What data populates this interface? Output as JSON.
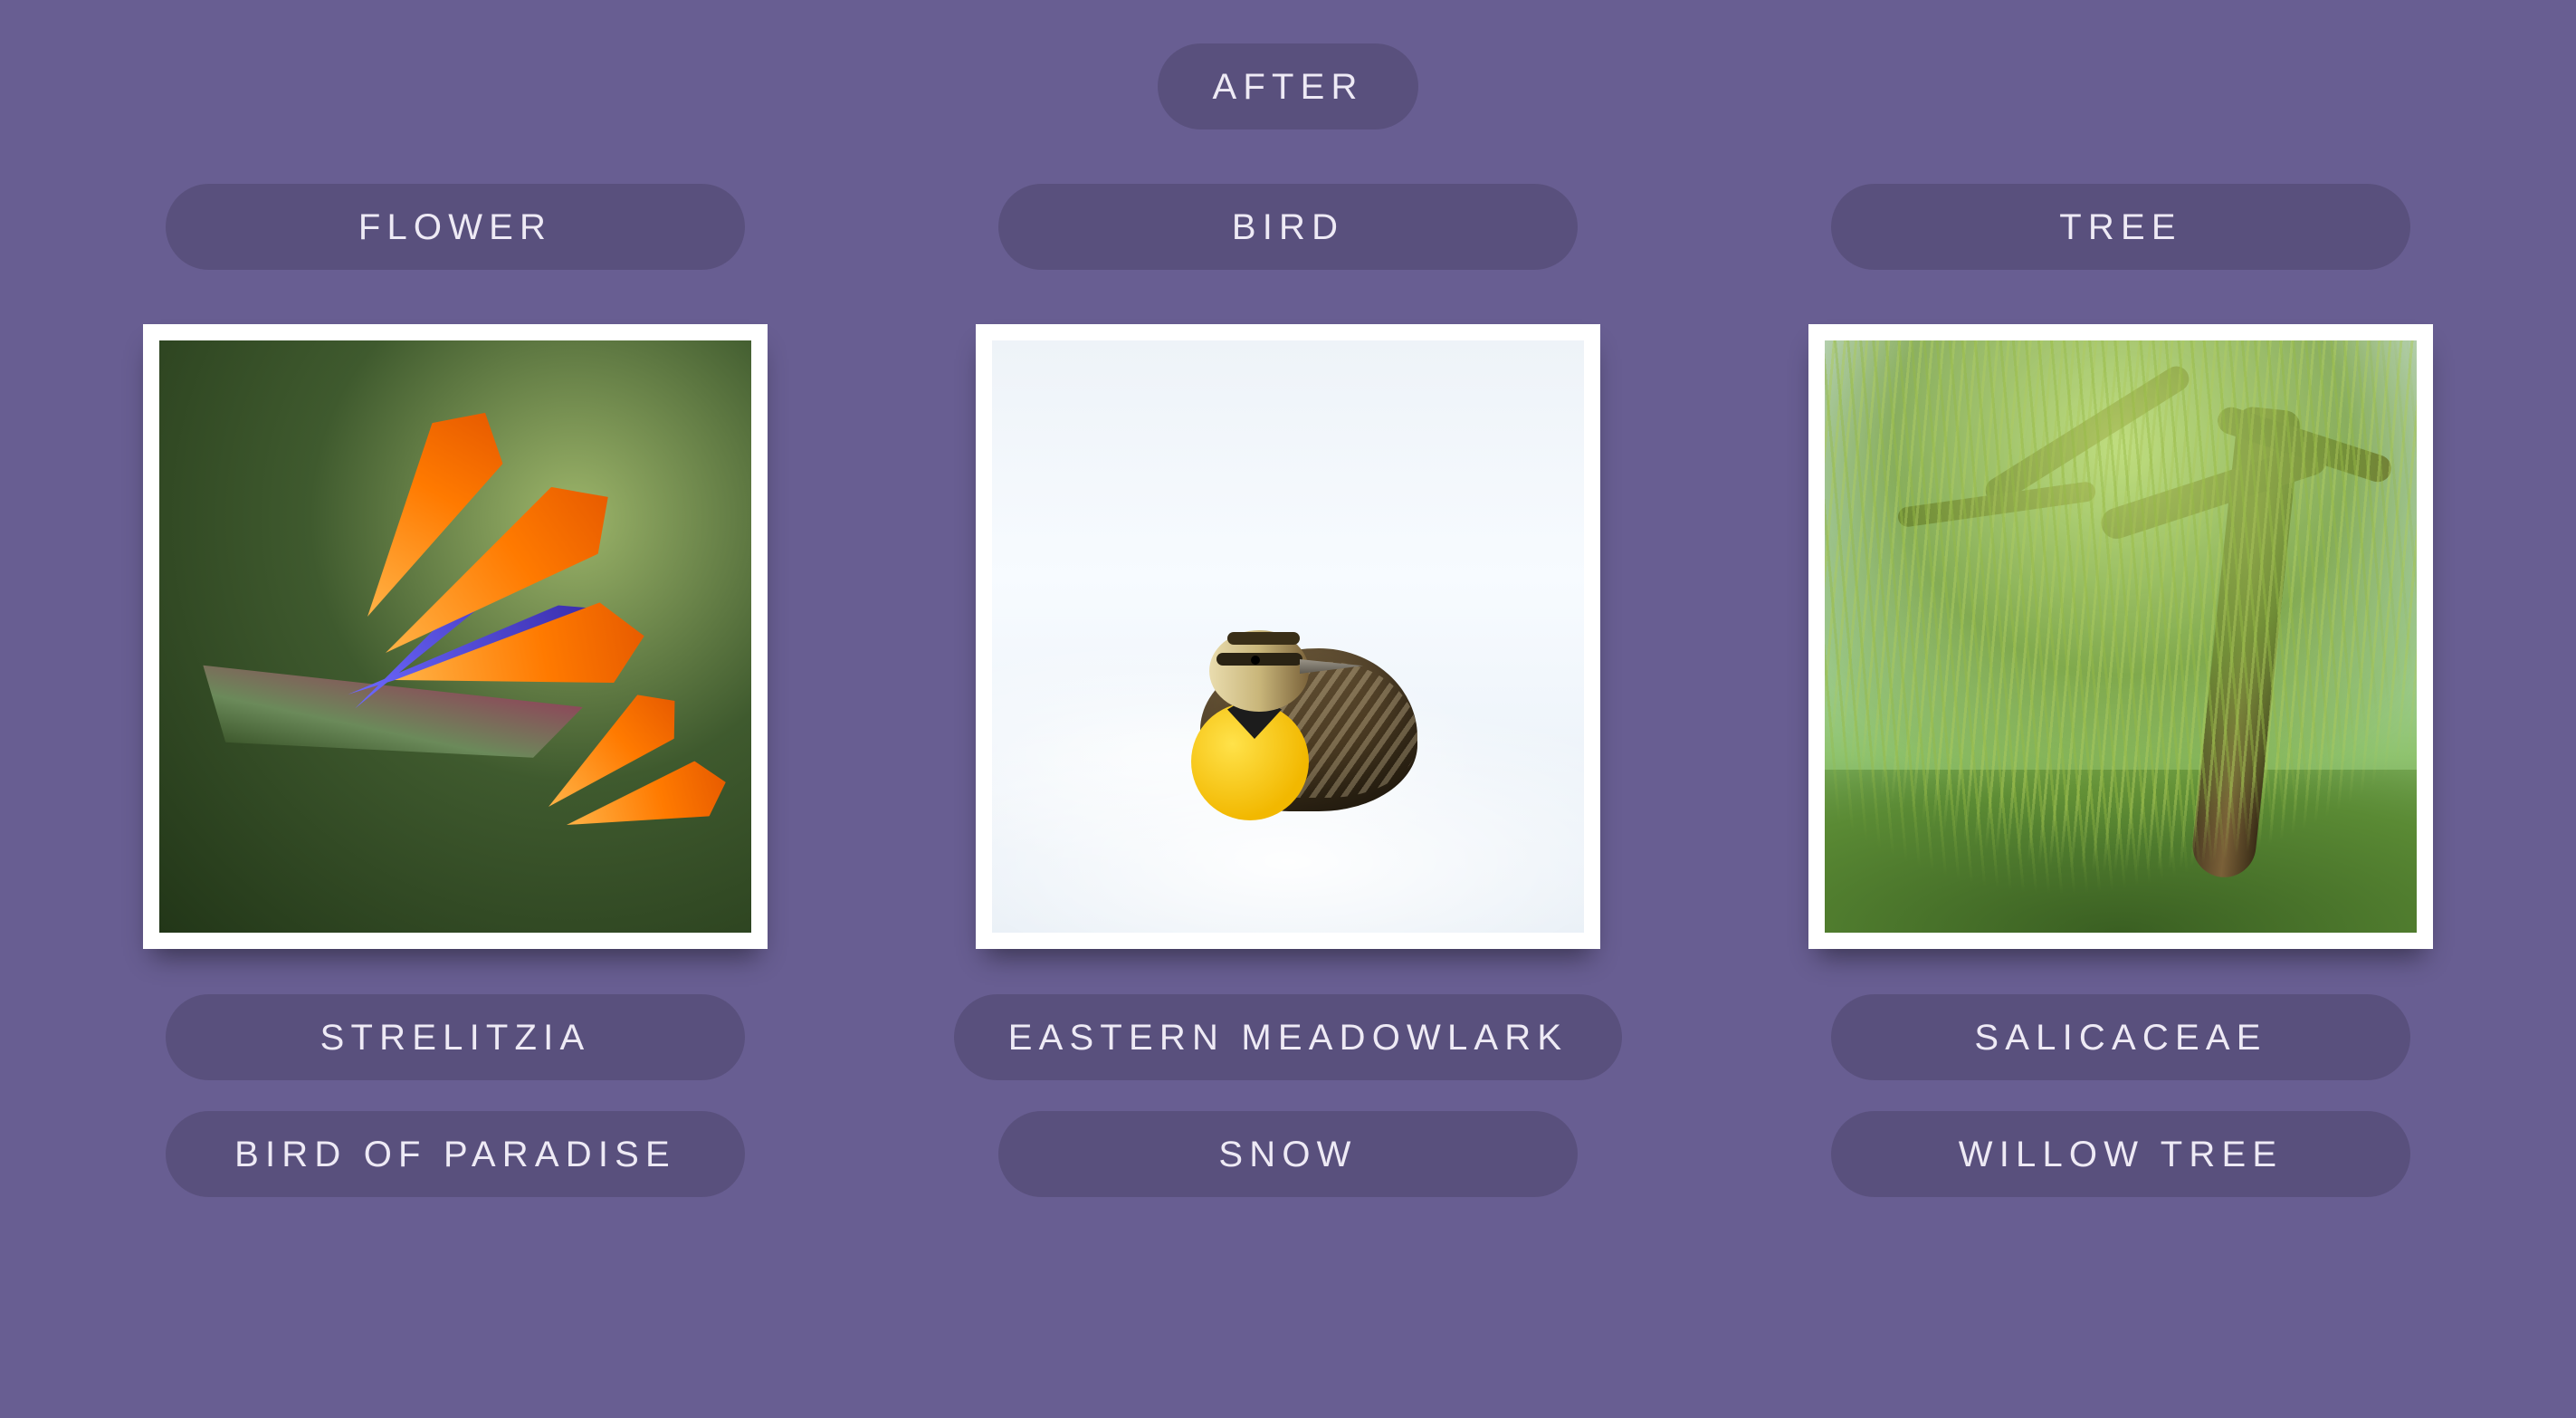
{
  "header": "AFTER",
  "columns": [
    {
      "category": "FLOWER",
      "tags": [
        "STRELITZIA",
        "BIRD OF PARADISE"
      ]
    },
    {
      "category": "BIRD",
      "tags": [
        "EASTERN MEADOWLARK",
        "SNOW"
      ]
    },
    {
      "category": "TREE",
      "tags": [
        "SALICACEAE",
        "WILLOW TREE"
      ]
    }
  ]
}
